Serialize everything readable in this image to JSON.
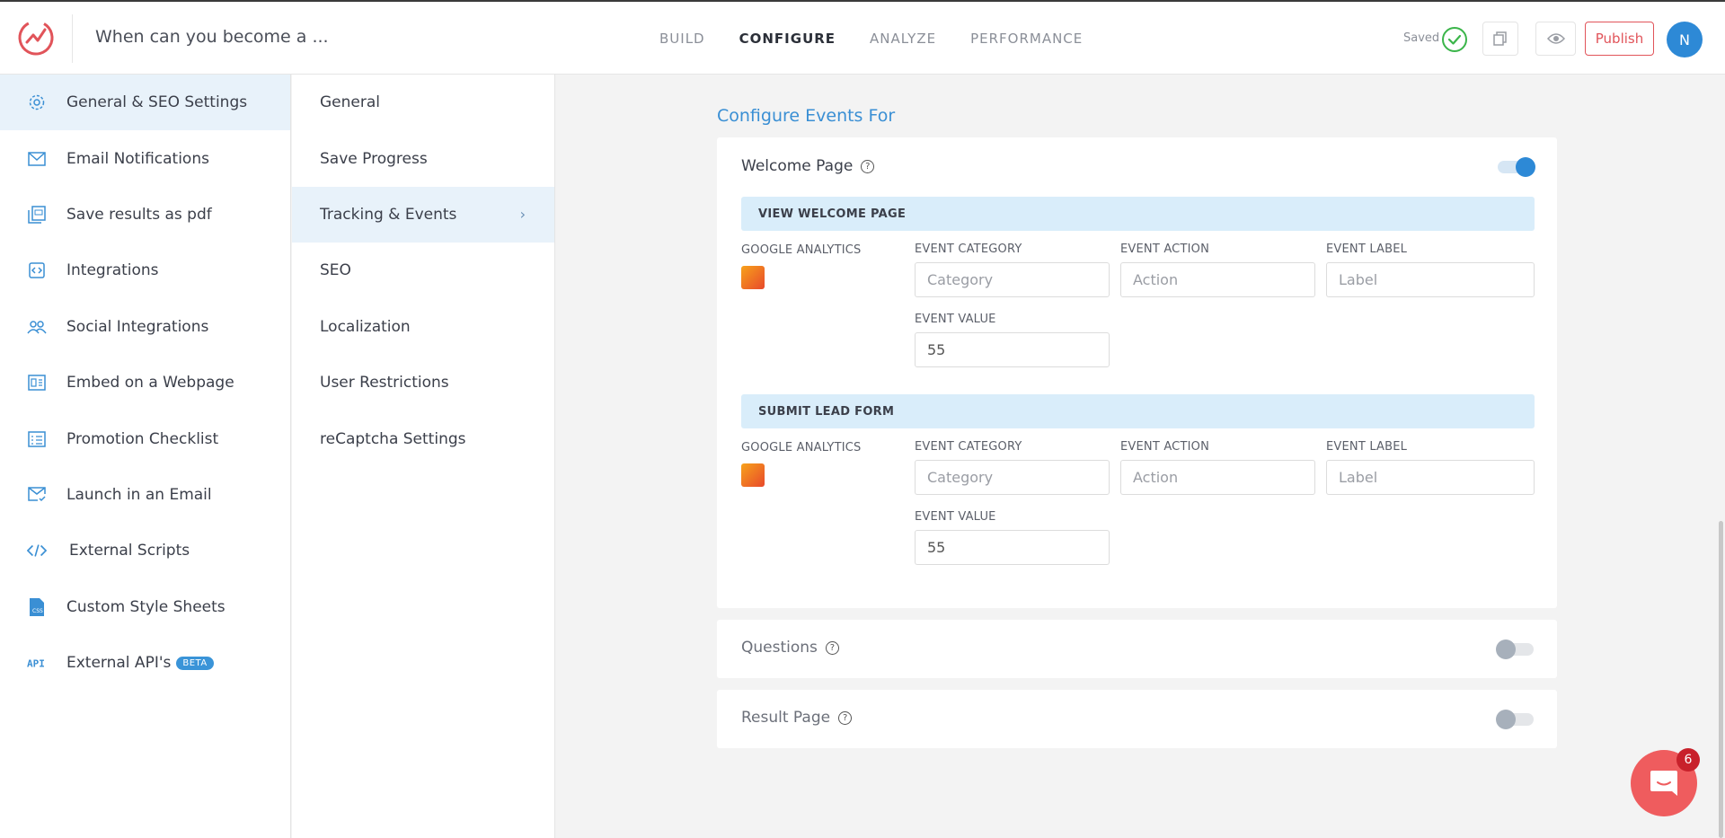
{
  "header": {
    "doc_title": "When can you become a ...",
    "tabs": [
      "BUILD",
      "CONFIGURE",
      "ANALYZE",
      "PERFORMANCE"
    ],
    "active_tab": "CONFIGURE",
    "saved_label": "Saved",
    "publish_label": "Publish",
    "avatar_initial": "N"
  },
  "sidebar": {
    "items": [
      {
        "label": "General & SEO Settings",
        "icon": "gear-icon"
      },
      {
        "label": "Email Notifications",
        "icon": "mail-icon"
      },
      {
        "label": "Save results as pdf",
        "icon": "pdf-icon"
      },
      {
        "label": "Integrations",
        "icon": "integration-icon"
      },
      {
        "label": "Social Integrations",
        "icon": "users-icon"
      },
      {
        "label": "Embed on a Webpage",
        "icon": "embed-icon"
      },
      {
        "label": "Promotion Checklist",
        "icon": "checklist-icon"
      },
      {
        "label": "Launch in an Email",
        "icon": "mail-send-icon"
      },
      {
        "label": "External Scripts",
        "icon": "code-icon"
      },
      {
        "label": "Custom Style Sheets",
        "icon": "css-file-icon"
      },
      {
        "label": "External API's",
        "icon": "api-icon",
        "badge": "BETA"
      }
    ],
    "active_index": 0
  },
  "submenu": {
    "items": [
      "General",
      "Save Progress",
      "Tracking & Events",
      "SEO",
      "Localization",
      "User Restrictions",
      "reCaptcha Settings"
    ],
    "active_index": 2
  },
  "main": {
    "section_title": "Configure Events For",
    "welcome": {
      "title": "Welcome Page",
      "toggle_on": true,
      "events": [
        {
          "bar_label": "VIEW WELCOME PAGE",
          "provider_label": "GOOGLE ANALYTICS",
          "category_label": "EVENT CATEGORY",
          "category_placeholder": "Category",
          "action_label": "EVENT ACTION",
          "action_placeholder": "Action",
          "label_label": "EVENT LABEL",
          "label_placeholder": "Label",
          "value_label": "EVENT VALUE",
          "value": "55"
        },
        {
          "bar_label": "SUBMIT LEAD FORM",
          "provider_label": "GOOGLE ANALYTICS",
          "category_label": "EVENT CATEGORY",
          "category_placeholder": "Category",
          "action_label": "EVENT ACTION",
          "action_placeholder": "Action",
          "label_label": "EVENT LABEL",
          "label_placeholder": "Label",
          "value_label": "EVENT VALUE",
          "value": "55"
        }
      ]
    },
    "questions": {
      "title": "Questions",
      "toggle_on": false
    },
    "result": {
      "title": "Result Page",
      "toggle_on": false
    }
  },
  "chat": {
    "badge_count": "6"
  },
  "colors": {
    "accent": "#2d89d6",
    "brand": "#e1545a",
    "active_bg": "#e8f2fa"
  }
}
